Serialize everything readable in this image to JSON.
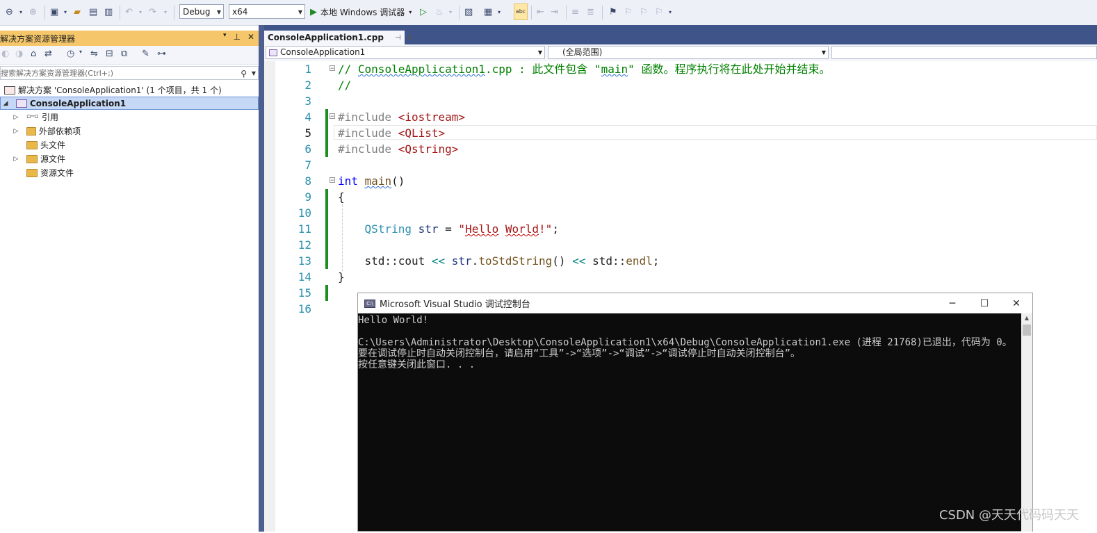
{
  "toolbar": {
    "configuration": "Debug",
    "platform": "x64",
    "run_label": "本地 Windows 调试器",
    "spell_label": "abc"
  },
  "solution_explorer": {
    "title": "解决方案资源管理器",
    "search_placeholder": "搜索解决方案资源管理器(Ctrl+;)",
    "solution_label": "解决方案 'ConsoleApplication1' (1 个项目，共 1 个)",
    "project_label": "ConsoleApplication1",
    "items": [
      {
        "label": "引用",
        "expandable": true,
        "icon": "references-icon"
      },
      {
        "label": "外部依赖项",
        "expandable": true,
        "icon": "external-deps-icon"
      },
      {
        "label": "头文件",
        "expandable": false,
        "icon": "folder-icon"
      },
      {
        "label": "源文件",
        "expandable": true,
        "icon": "folder-icon"
      },
      {
        "label": "资源文件",
        "expandable": false,
        "icon": "folder-icon"
      }
    ]
  },
  "editor": {
    "active_tab": "ConsoleApplication1.cpp",
    "nav_project": "ConsoleApplication1",
    "nav_scope": "(全局范围)",
    "lines": [
      {
        "n": "1",
        "tokens": [
          [
            "cmt",
            "// "
          ],
          [
            "cmt squigb",
            "ConsoleApplication1"
          ],
          [
            "cmt",
            ".cpp : 此文件包含 \""
          ],
          [
            "cmt squigb",
            "main"
          ],
          [
            "cmt",
            "\" 函数。程序执行将在此处开始并结束。"
          ]
        ]
      },
      {
        "n": "2",
        "tokens": [
          [
            "cmt",
            "//"
          ]
        ]
      },
      {
        "n": "3",
        "tokens": []
      },
      {
        "n": "4",
        "tokens": [
          [
            "pp",
            "#include "
          ],
          [
            "inc",
            "<iostream>"
          ]
        ]
      },
      {
        "n": "5",
        "tokens": [
          [
            "pp",
            "#include "
          ],
          [
            "inc",
            "<QList>"
          ]
        ]
      },
      {
        "n": "6",
        "tokens": [
          [
            "pp",
            "#include "
          ],
          [
            "inc",
            "<Qstring>"
          ]
        ]
      },
      {
        "n": "7",
        "tokens": []
      },
      {
        "n": "8",
        "tokens": [
          [
            "kw",
            "int"
          ],
          [
            "plain",
            " "
          ],
          [
            "fn squigb",
            "main"
          ],
          [
            "plain",
            "()"
          ]
        ]
      },
      {
        "n": "9",
        "tokens": [
          [
            "plain",
            "{"
          ]
        ]
      },
      {
        "n": "10",
        "tokens": []
      },
      {
        "n": "11",
        "tokens": [
          [
            "plain",
            "    "
          ],
          [
            "ty",
            "QString"
          ],
          [
            "plain",
            " "
          ],
          [
            "var",
            "str"
          ],
          [
            "plain",
            " = "
          ],
          [
            "str",
            "\""
          ],
          [
            "str squig",
            "Hello"
          ],
          [
            "str",
            " "
          ],
          [
            "str squig",
            "World"
          ],
          [
            "str",
            "!\""
          ],
          [
            "plain",
            ";"
          ]
        ]
      },
      {
        "n": "12",
        "tokens": []
      },
      {
        "n": "13",
        "tokens": [
          [
            "plain",
            "    std::cout "
          ],
          [
            "op",
            "<<"
          ],
          [
            "plain",
            " "
          ],
          [
            "var",
            "str"
          ],
          [
            "plain",
            "."
          ],
          [
            "fn",
            "toStdString"
          ],
          [
            "plain",
            "() "
          ],
          [
            "op",
            "<<"
          ],
          [
            "plain",
            " std::"
          ],
          [
            "fn",
            "endl"
          ],
          [
            "plain",
            ";"
          ]
        ]
      },
      {
        "n": "14",
        "tokens": [
          [
            "plain",
            "}"
          ]
        ]
      },
      {
        "n": "15",
        "tokens": []
      },
      {
        "n": "16",
        "tokens": []
      }
    ]
  },
  "console": {
    "title": "Microsoft Visual Studio 调试控制台",
    "lines": [
      "Hello World!",
      "",
      "C:\\Users\\Administrator\\Desktop\\ConsoleApplication1\\x64\\Debug\\ConsoleApplication1.exe (进程 21768)已退出，代码为 0。",
      "要在调试停止时自动关闭控制台，请启用“工具”->“选项”->“调试”->“调试停止时自动关闭控制台”。",
      "按任意键关闭此窗口. . ."
    ]
  },
  "watermark": "CSDN @天天代码码天天"
}
